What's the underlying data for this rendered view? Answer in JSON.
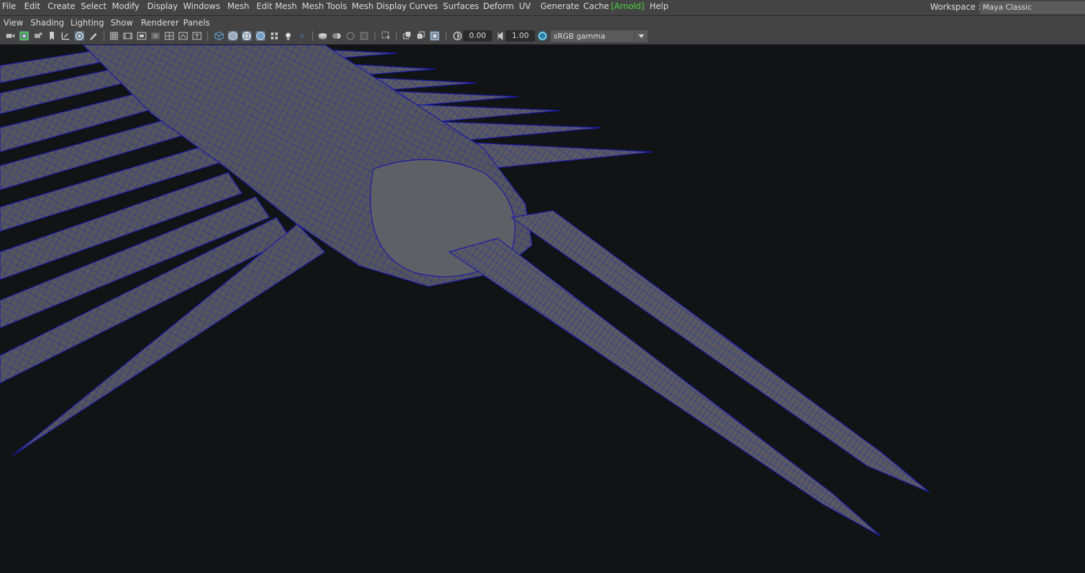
{
  "menubar": {
    "items": [
      "File",
      "Edit",
      "Create",
      "Select",
      "Modify",
      "Display",
      "Windows",
      "Mesh",
      "Edit Mesh",
      "Mesh Tools",
      "Mesh Display",
      "Curves",
      "Surfaces",
      "Deform",
      "UV",
      "Generate",
      "Cache",
      "[Arnold]",
      "Help"
    ],
    "workspace_label": "Workspace :",
    "workspace_value": "Maya Classic"
  },
  "panel_menu": {
    "items": [
      "View",
      "Shading",
      "Lighting",
      "Show",
      "Renderer",
      "Panels"
    ]
  },
  "toolbar": {
    "exposure": "0.00",
    "gamma": "1.00",
    "color_space": "sRGB gamma",
    "icons": [
      "select-camera-icon",
      "camera-attributes-icon",
      "bookmark-icon",
      "image-plane-icon",
      "2d-pan-zoom-icon",
      "grease-pencil-icon",
      "grid-icon",
      "film-gate-icon",
      "resolution-gate-icon",
      "gate-mask-icon",
      "field-chart-icon",
      "safe-action-icon",
      "safe-title-icon",
      "wireframe-icon",
      "smooth-shade-icon",
      "wireframe-on-shaded-icon",
      "default-material-icon",
      "xray-icon",
      "use-all-lights-icon",
      "shadows-icon",
      "screen-space-ao-icon",
      "motion-blur-icon",
      "multisample-aa-icon",
      "depth-of-field-icon",
      "isolate-select-icon",
      "xray-joints-icon",
      "xray-active-icon",
      "backface-culling-icon",
      "exposure-icon",
      "gamma-icon",
      "color-management-icon"
    ]
  },
  "viewport": {
    "mesh_color": "#55555c",
    "wire_color": "#1a1ab8",
    "background": "#111315"
  }
}
